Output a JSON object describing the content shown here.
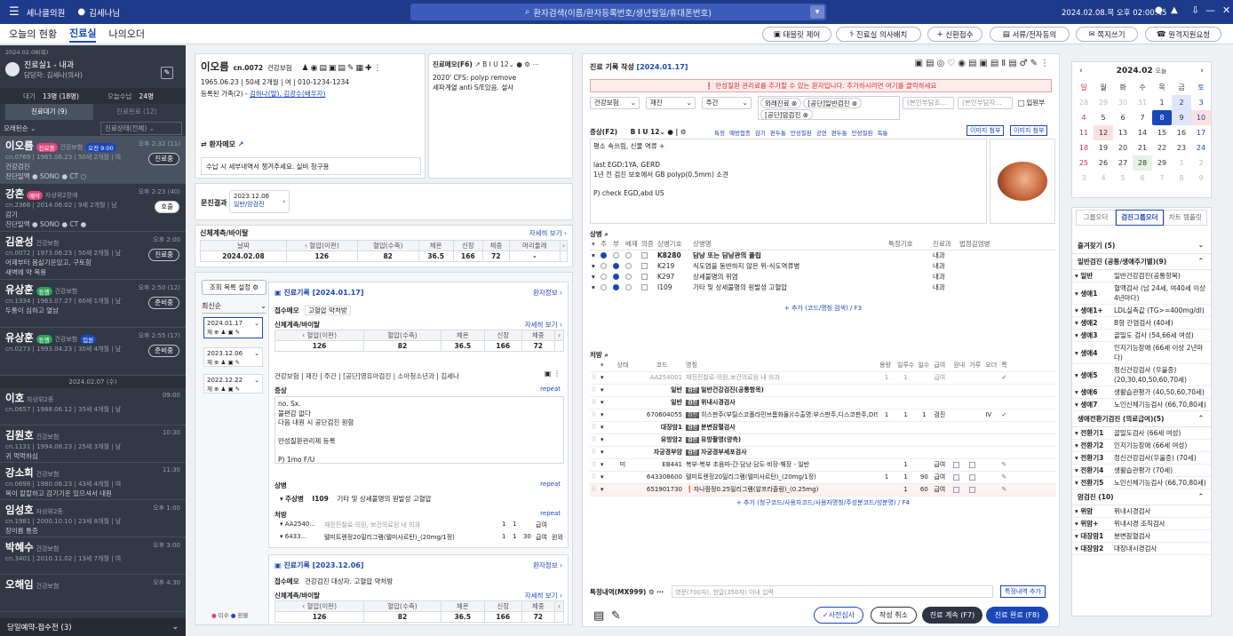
{
  "topbar": {
    "hospital": "세나클의원",
    "user": "김세나님",
    "search_placeholder": "환자검색(이름/환자등록번호/생년월일/휴대폰번호)",
    "datetime": "2024.02.08.목 오후 02:00:45"
  },
  "nav": {
    "tabs": [
      "오늘의 현황",
      "진료실",
      "나의오더"
    ],
    "active": 1
  },
  "toolbar": [
    "태블릿 제어",
    "진료실 의사배치",
    "신환접수",
    "서류/전자동의",
    "쪽지쓰기",
    "원격지원요청"
  ],
  "room": {
    "date": "2024.02.08(목)",
    "name": "진료실1 - 내과",
    "doctor": "담당자: 김세나(의사)",
    "wait_label": "대기",
    "wait_value": "13명 (18명)",
    "recv_label": "오늘수납",
    "recv_value": "24명",
    "tab_wait": "진료대기 (9)",
    "tab_done": "진료완료 (12)",
    "filter1": "오래된순",
    "filter2": "진료상태(전체)",
    "footer": "당일예약-접수전 (3)"
  },
  "waiting": [
    {
      "name": "이오름",
      "badge": "진료중",
      "badge_color": "#e0457b",
      "ins": "건강보험",
      "appt": "오전 9:00",
      "time": "오후 2:32 (11)",
      "info": "cn.0769 | 1965.06.23 | 50세 2개월 | 여",
      "l1": "건강검진",
      "l2": "진단일액 ● SONO ● CT ○",
      "btn": "진료중"
    },
    {
      "name": "강혼",
      "badge": "예약",
      "badge_color": "#e0457b",
      "ins": "자상위2장애",
      "appt": "",
      "time": "오후 2:23 (40)",
      "info": "cn.2366 | 2014.06.02 | 9세 2개월 | 남",
      "l1": "감기",
      "l2": "진단일액 ● SONO ● CT ●",
      "btn": "호출"
    },
    {
      "name": "김윤성",
      "badge": "",
      "badge_color": "",
      "ins": "건강보험",
      "appt": "",
      "time": "오후 2:00",
      "info": "cn.0072 | 1973.06.23 | 50세 2개월 | 남",
      "l1": "어제부터 몸살기운있고, 구토함",
      "l2": "새벽에 약 복용",
      "btn": "진료중"
    },
    {
      "name": "유상훈",
      "badge": "동행",
      "badge_color": "#2f9e5a",
      "ins": "건강보험",
      "appt": "",
      "time": "오후 2:50 (12)",
      "info": "cn.1334 | 1963.07.27 | 60세 1개월 | 남",
      "l1": "두통이 심하고 열남",
      "l2": "",
      "btn": "준비중"
    },
    {
      "name": "유상훈",
      "badge": "동행",
      "badge_color": "#2f9e5a",
      "ins": "건강보험",
      "appt": "입원",
      "time": "오후 2:55 (17)",
      "info": "cn.0273 | 1993.04.23 | 30세 4개월 | 남",
      "l1": "",
      "l2": "",
      "btn": "준비중"
    }
  ],
  "date_sep": "2024.02.07 (수)",
  "past": [
    {
      "name": "이호",
      "ins": "차상위2종",
      "time": "09:00",
      "info": "cn.0657 | 1988.06.12 | 35세 4개월 | 남",
      "l1": ""
    },
    {
      "name": "김원호",
      "ins": "건강보험",
      "time": "10:30",
      "info": "cn.1131 | 1994.08.23 | 25세 3개월 | 남",
      "l1": "귀 먹먹하심"
    },
    {
      "name": "강소희",
      "ins": "건강보험",
      "time": "11:30",
      "info": "cn.0698 | 1980.06.23 | 43세 4개월 | 여",
      "l1": "목이 칼칼하고 감기기운 있으셔서 내원"
    },
    {
      "name": "임성호",
      "ins": "자상위2종",
      "time": "오후 1:00",
      "info": "cn.1981 | 2000.10.10 | 23세 8개월 | 남",
      "l1": "장이름 통증"
    },
    {
      "name": "박혜수",
      "ins": "건강보험",
      "time": "오후 3:00",
      "info": "cn.3401 | 2010.11.02 | 13세 7개월 | 여",
      "l1": ""
    },
    {
      "name": "오해임",
      "ins": "건강보험",
      "time": "오후 4:30",
      "info": "",
      "l1": ""
    }
  ],
  "patient": {
    "name": "이오름",
    "cn": "cn.0072",
    "ins": "건강보험",
    "info": "1965.06.23 | 50세 2개월 | 여 | 010-1234-1234",
    "family_label": "등록된 가족(2) -",
    "family": "김하나(딸), 김광수(배우자)",
    "memo_title": "진료메모(F6)",
    "memo": "2020' CFS: polyp remove\n세파계열 anti S/E있음. 설사",
    "pmemo_title": "환자메모",
    "pmemo": "수납 시 세부내역서 챙겨주세요. 실비 청구용"
  },
  "questionnaire": {
    "label": "문진결과",
    "date": "2023.12.06",
    "type": "일반/암검진"
  },
  "vitals": {
    "title": "신체계측/바이탈",
    "more": "자세히 보기",
    "headers": [
      "날짜",
      "혈압(이완)",
      "혈압(수축)",
      "체온",
      "신장",
      "체중",
      "머리둘레"
    ],
    "row": [
      "2024.02.08",
      "126",
      "82",
      "36.5",
      "166",
      "72",
      "-"
    ]
  },
  "history": {
    "settings": "조회 목록 설정",
    "sort": "최신순",
    "dates": [
      "2024.01.17",
      "2023.12.06",
      "2022.12.22"
    ],
    "legend1": "미수",
    "legend2": "환불"
  },
  "record1": {
    "title": "진료기록 [2024.01.17]",
    "link": "환자정보",
    "memo_label": "접수메모",
    "memo": "고혈압 약처방",
    "vit_title": "신체계측/바이탈",
    "vit_more": "자세히 보기",
    "vh": [
      "혈압(이완)",
      "혈압(수축)",
      "체온",
      "신장",
      "체중"
    ],
    "vr": [
      "126",
      "82",
      "36.5",
      "166",
      "72"
    ],
    "chips": "건강보험 | 재진 | 주간 | [공단]영유아검진 | 소아청소년과 | 김세나",
    "symptom_label": "증상",
    "repeat": "repeat",
    "symptom": "no. Sx.\n불편감 없다\n다음 내원 시 공단검진 원함\n\n만성질환관리제 등록\n\nP) 1mo F/U",
    "dx_label": "상병",
    "dx_type": "주상병",
    "dx_code": "I109",
    "dx_name": "기타 및 상세불명의 원발성 고혈압",
    "rx_label": "처방",
    "rx": [
      {
        "code": "AA2540...",
        "name": "재진진찰료-의원, 보건의료원 내 의과",
        "d": "1",
        "n": "1",
        "t": "",
        "p": "급여",
        "o": ""
      },
      {
        "code": "6433...",
        "name": "텔미트렌정20밀리그램(텔미사르탄)_(20mg/1정)",
        "d": "1",
        "n": "1",
        "t": "30",
        "p": "급여",
        "o": "원외"
      }
    ]
  },
  "record2": {
    "title": "진료기록 [2023.12.06]",
    "link": "환자정보",
    "memo_label": "접수메모",
    "memo": "건강검진 대상자. 고혈압 약처방",
    "vit_title": "신체계측/바이탈",
    "vit_more": "자세히 보기",
    "vr": [
      "126",
      "82",
      "36.5",
      "166",
      "72"
    ]
  },
  "writing": {
    "title": "진료 기록 작성",
    "date": "[2024.01.17]",
    "alert": "만성질환 관리료를 추가할 수 있는 환자입니다. 추가하시려면 여기를 클릭하세요",
    "sel": [
      "건강보험",
      "재진",
      "주간"
    ],
    "chips": [
      "외래진료",
      "[공단]일반검진",
      "[공단]암검진"
    ],
    "sel2": "(본인부담조...",
    "sel3": "(본인부담자...",
    "inpatient": "입원부",
    "sym_label": "증상(F2)",
    "quick": [
      "특정",
      "예방접종",
      "감기",
      "편두통",
      "만성질환",
      "공연",
      "편두통",
      "만성질환",
      "독통"
    ],
    "img_attach": "이미지 첨부",
    "img_attach2": "이미지 첨부",
    "symptom": "평소 속쓰림, 신물 역류 +\n\nlast EGD:1YA, GERD\n1년 전 검진 보호에서 GB polyp(0.5mm) 소견\n\nP) check EGD,abd US"
  },
  "dx": {
    "label": "상병",
    "headers": [
      "주",
      "부",
      "배제",
      "의증",
      "상병기호",
      "상병명",
      "특정기호",
      "진료과",
      "법정감염병"
    ],
    "rows": [
      {
        "m": true,
        "s": false,
        "code": "K8280",
        "name": "담낭 또는 담낭관의 폴립",
        "dept": "내과",
        "bold": true
      },
      {
        "m": false,
        "s": true,
        "code": "K219",
        "name": "식도염을 동반하지 않은 위-식도역류병",
        "dept": "내과"
      },
      {
        "m": false,
        "s": true,
        "code": "K297",
        "name": "상세불명의 위염",
        "dept": "내과"
      },
      {
        "m": false,
        "s": true,
        "code": "I109",
        "name": "기타 및 상세불명의 원발성 고혈압",
        "dept": "내과"
      }
    ],
    "add": "+ 추가 (코드/명칭 검색) / F3"
  },
  "rx": {
    "label": "처방",
    "headers": [
      "상태",
      "코드",
      "명칭",
      "용량",
      "일투수",
      "일수",
      "급여",
      "원내",
      "가루",
      "오더",
      "특"
    ],
    "rows": [
      {
        "st": "",
        "code": "AA254001",
        "name": "재진진찰료-의원,보건의료원 내 의과",
        "g": false,
        "d": "1",
        "n": "1",
        "t": "",
        "p": "급여",
        "grey": true,
        "check": true
      },
      {
        "st": "",
        "code": "일반",
        "name": "일반건강검진(공통항목)",
        "g": true,
        "d": "",
        "n": "",
        "t": "",
        "p": "",
        "bold": true
      },
      {
        "st": "",
        "code": "일반",
        "name": "위내시경검사",
        "g": true,
        "d": "",
        "n": "",
        "t": "",
        "p": "",
        "bold": true
      },
      {
        "st": "",
        "code": "670604055",
        "name": "히스판주(부틸스코폴라민브롬화물)(수출명:부스판주,디스코판주,DIS...",
        "g": true,
        "d": "1",
        "n": "1",
        "t": "1",
        "p": "검진",
        "iv": "IV",
        "check": true
      },
      {
        "st": "",
        "code": "대장암1",
        "name": "분변잠혈검사",
        "g": true,
        "d": "",
        "n": "",
        "t": "",
        "p": "",
        "bold": true
      },
      {
        "st": "",
        "code": "유방암2",
        "name": "유방촬영(양측)",
        "g": true,
        "d": "",
        "n": "",
        "t": "",
        "p": "",
        "bold": true
      },
      {
        "st": "",
        "code": "자궁경부암",
        "name": "자궁경부세포검사",
        "g": true,
        "d": "",
        "n": "",
        "t": "",
        "p": "",
        "bold": true
      },
      {
        "st": "미",
        "code": "EB441",
        "name": "복부-복부 초음파-간·담낭·담도·비장·췌장 - 일반",
        "g": false,
        "d": "",
        "n": "1",
        "t": "",
        "p": "급여",
        "pen": true
      },
      {
        "st": "",
        "code": "643308600",
        "name": "텔미트렌정20밀리그램(텔미사르탄)_(20mg/1정)",
        "g": false,
        "d": "1",
        "n": "1",
        "t": "90",
        "p": "급여",
        "pen": true
      },
      {
        "st": "",
        "code": "651901730",
        "name": "자나팜정0.25밀리그램(알프라졸람)_(0.25mg)",
        "g": false,
        "d": "",
        "n": "1",
        "t": "60",
        "p": "급여",
        "warn": true,
        "pen": true
      }
    ],
    "add": "+ 추가 (청구코드/사용자코드/사용자명칭/주성분코드/성분명) / F4"
  },
  "special": {
    "label": "특정내역(MX999)",
    "placeholder": "영문(700자), 한글(350자) 이내 입력",
    "btn": "특정내역 추가"
  },
  "actions": {
    "pre": "사전심사",
    "cancel": "작성 취소",
    "cont": "진료 계속 (F7)",
    "done": "진료 완료 (F8)"
  },
  "calendar": {
    "month": "2024.02",
    "today_label": "오늘",
    "weekdays": [
      "일",
      "월",
      "화",
      "수",
      "목",
      "금",
      "토"
    ],
    "weeks": [
      [
        "28",
        "29",
        "30",
        "31",
        "1",
        "2",
        "3"
      ],
      [
        "4",
        "5",
        "6",
        "7",
        "8",
        "9",
        "10"
      ],
      [
        "11",
        "12",
        "13",
        "14",
        "15",
        "16",
        "17"
      ],
      [
        "18",
        "19",
        "20",
        "21",
        "22",
        "23",
        "24"
      ],
      [
        "25",
        "26",
        "27",
        "28",
        "29",
        "1",
        "2"
      ],
      [
        "3",
        "4",
        "5",
        "6",
        "7",
        "8",
        "9"
      ]
    ]
  },
  "rtabs": [
    "그룹오더",
    "검진그룹오더",
    "차트 템플릿"
  ],
  "rgroups": [
    {
      "title": "즐겨찾기 (5)",
      "items": []
    },
    {
      "title": "일반검진 (공통/생애주기별)(9)",
      "items": [
        [
          "일반",
          "일반건강검진(공통항목)"
        ],
        [
          "생애1",
          "혈액검사 (남 24세, 여40세 이상 4년마다)"
        ],
        [
          "생애1+",
          "LDL실측값 (TG>=400mg/dl)"
        ],
        [
          "생애2",
          "B형 간염검사 (40세)"
        ],
        [
          "생애3",
          "골밀도 검사 (54,66세 여성)"
        ],
        [
          "생애4",
          "인지기능장애 (66세 이상 2년마다)"
        ],
        [
          "생애5",
          "정신건강검사 (우울증) (20,30,40,50,60,70세)"
        ],
        [
          "생애6",
          "생활습관평가 (40,50,60,70세)"
        ],
        [
          "생애7",
          "노인신체기능검사 (66,70,80세)"
        ]
      ]
    },
    {
      "title": "생애전환기검진 (의료급여)(5)",
      "items": [
        [
          "전환기1",
          "골밀도검사 (66세 여성)"
        ],
        [
          "전환기2",
          "인지기능장애 (66세 여성)"
        ],
        [
          "전환기3",
          "정신건강검사(우울증) (70세)"
        ],
        [
          "전환기4",
          "생활습관평가 (70세)"
        ],
        [
          "전환기5",
          "노인신체기능검사 (66,70,80세)"
        ]
      ]
    },
    {
      "title": "암검진 (10)",
      "items": [
        [
          "위암",
          "위내시경검사"
        ],
        [
          "위암+",
          "위내시경 조직검사"
        ],
        [
          "대장암1",
          "분변잠혈검사"
        ],
        [
          "대장암2",
          "대장내시경검사"
        ]
      ]
    }
  ],
  "colors": {
    "topbar": "#1e3a8a",
    "accent": "#1a47b8",
    "leftpanel": "#323844",
    "alert": "#d8323c"
  }
}
